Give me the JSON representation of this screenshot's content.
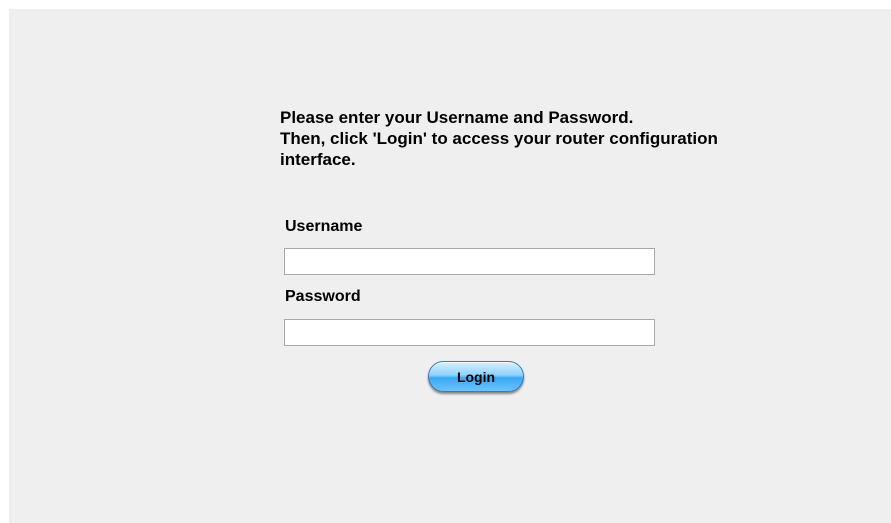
{
  "instructions": {
    "line1": "Please enter your Username and Password.",
    "line2": "Then, click 'Login' to access your router configuration",
    "line3": "interface."
  },
  "form": {
    "username_label": "Username",
    "username_value": "",
    "password_label": "Password",
    "password_value": "",
    "login_label": "Login"
  },
  "colors": {
    "panel_background": "#efefef",
    "button_blue": "#3aa7f2"
  }
}
